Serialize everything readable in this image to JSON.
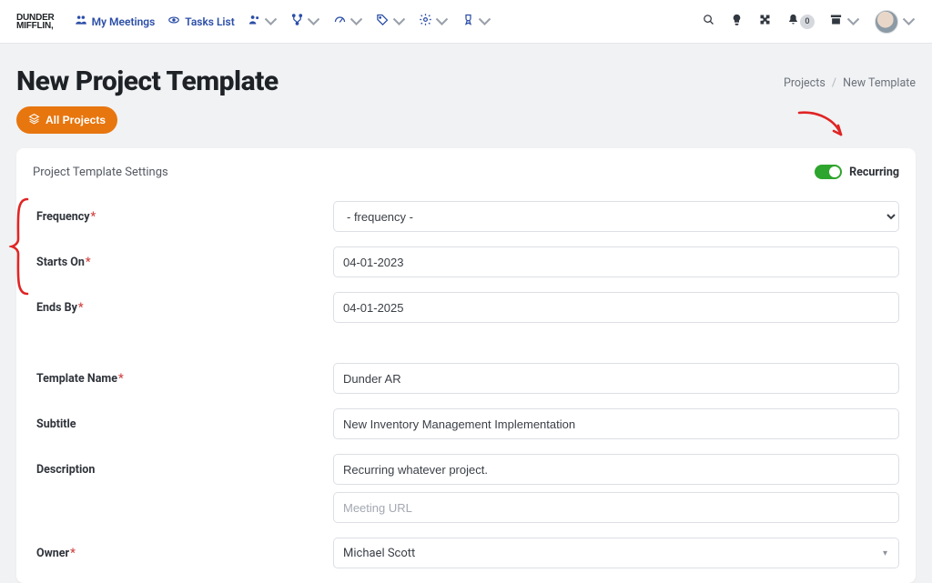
{
  "brand": {
    "line1": "DUNDER",
    "line2": "MIFFLIN,"
  },
  "nav": {
    "my_meetings": "My Meetings",
    "tasks_list": "Tasks List",
    "bell_count": "0"
  },
  "page": {
    "title": "New Project Template",
    "all_projects_btn": "All Projects"
  },
  "breadcrumb": {
    "root": "Projects",
    "current": "New Template"
  },
  "card": {
    "title": "Project Template Settings",
    "recurring_label": "Recurring"
  },
  "form": {
    "labels": {
      "frequency": "Frequency",
      "starts_on": "Starts On",
      "ends_by": "Ends By",
      "template_name": "Template Name",
      "subtitle": "Subtitle",
      "description": "Description",
      "owner": "Owner"
    },
    "values": {
      "frequency_placeholder": "- frequency -",
      "starts_on": "04-01-2023",
      "ends_by": "04-01-2025",
      "template_name": "Dunder AR",
      "subtitle": "New Inventory Management Implementation",
      "description": "Recurring whatever project.",
      "meeting_url_placeholder": "Meeting URL",
      "owner": "Michael Scott"
    }
  }
}
